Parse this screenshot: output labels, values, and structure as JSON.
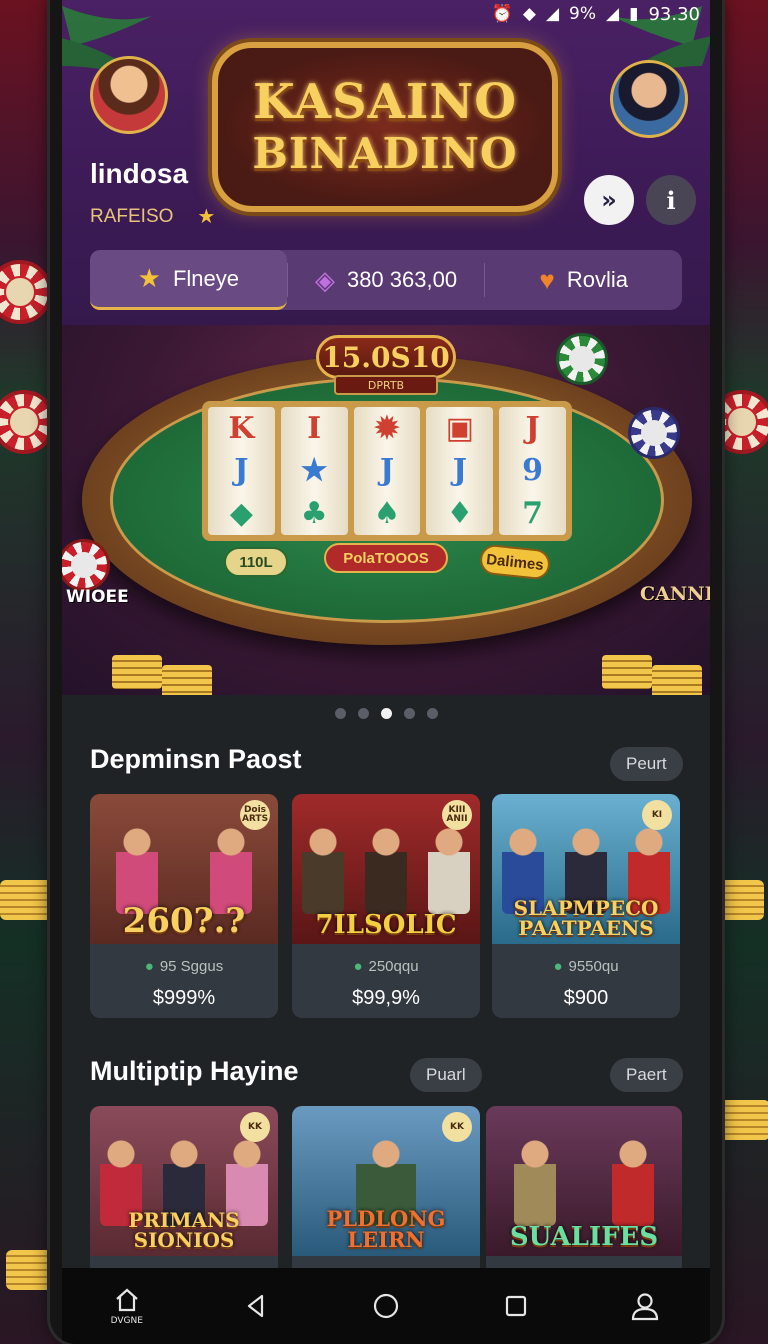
{
  "status_bar": {
    "battery": "9%",
    "time": "93.30"
  },
  "header": {
    "logo_line1": "KASAINO",
    "logo_line2": "BINADINO",
    "username": "lindosa",
    "rank": "RAFEISO",
    "stats": [
      {
        "icon": "star-icon",
        "label": "Flneye"
      },
      {
        "icon": "gem-icon",
        "label": "380 363,00"
      },
      {
        "icon": "heart-icon",
        "label": "Rovlia"
      }
    ]
  },
  "banner": {
    "jackpot": "15.0S10",
    "jackpot_sub": "DPRTB",
    "reels": [
      [
        "K",
        "J",
        "◆"
      ],
      [
        "I",
        "★",
        "♣"
      ],
      [
        "✹",
        "J",
        "♠"
      ],
      [
        "▣",
        "J",
        "♦"
      ],
      [
        "J",
        "9",
        "7"
      ]
    ],
    "pill_left": "110L",
    "pill_mid": "PolaTOOOS",
    "pill_right": "Dalimes",
    "tag_left": "WIOEE",
    "tag_right": "CANNI",
    "dots": 5,
    "active_dot": 2
  },
  "section1": {
    "title": "Depminsn Paost",
    "button": "Peurt",
    "cards": [
      {
        "art_title": "260?.?",
        "badge": "Dois ARTS",
        "tokens": "95 Sggus",
        "price": "$999%",
        "bg": "#7a3a3a",
        "people": [
          "#d04a7a",
          "#d04a7a"
        ]
      },
      {
        "art_title": "7ILSOLIC",
        "badge": "KIII ANII",
        "tokens": "250qqu",
        "price": "$99,9%",
        "bg": "#8a2a2a",
        "people": [
          "#4a3a2a",
          "#3a2a20",
          "#d8d0c0"
        ]
      },
      {
        "art_title": "SLAPMPECO PAATPAENS",
        "badge": "KI",
        "tokens": "9550qu",
        "price": "$900",
        "bg": "#3a8ab0",
        "people": [
          "#2a4a9a",
          "#2a2a3a",
          "#c02a2a"
        ]
      }
    ]
  },
  "section2": {
    "title": "Multiptip Hayine",
    "button_mid": "Puarl",
    "button": "Paert",
    "cards": [
      {
        "art_title": "PRIMANS SIONIOS",
        "badge": "KK",
        "bg": "#7a3a4a",
        "people": [
          "#c02a3a",
          "#2a2a3a",
          "#d88ab0"
        ]
      },
      {
        "art_title": "PLDLONG LEIRN",
        "badge": "KK",
        "bg": "#4a7aa0",
        "people": [
          "#3a5a3a"
        ]
      },
      {
        "art_title": "SUALIFES",
        "badge": "",
        "bg": "#5a2a3a",
        "people": [
          "#a08a5a",
          "#c02a2a"
        ]
      }
    ]
  },
  "nav": {
    "home_label": "DVGNE"
  }
}
